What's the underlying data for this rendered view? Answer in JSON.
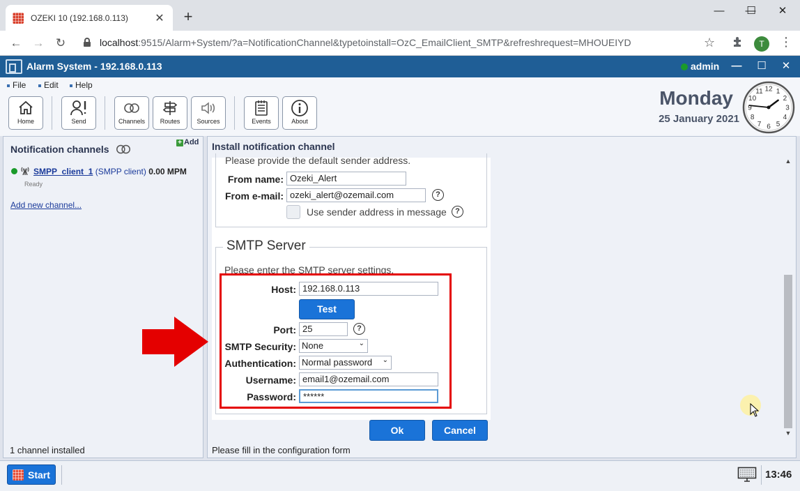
{
  "browser": {
    "tab_title": "OZEKI 10 (192.168.0.113)",
    "tab_close": "✕",
    "new_tab": "+",
    "url_host": "localhost",
    "url_path": ":9515/Alarm+System/?a=NotificationChannel&typetoinstall=OzC_EmailClient_SMTP&refreshrequest=MHOUEIYD",
    "profile_initial": "T",
    "back": "←",
    "forward": "→",
    "reload": "↻",
    "star": "☆",
    "menu": "⋮",
    "minimize": "—",
    "maximize": "☐",
    "close": "✕"
  },
  "app": {
    "title": "Alarm System - 192.168.0.113",
    "user": "admin",
    "minimize": "—",
    "maximize": "☐",
    "close": "✕"
  },
  "menu": {
    "file": "File",
    "edit": "Edit",
    "help": "Help"
  },
  "toolbar": {
    "home": "Home",
    "send": "Send",
    "channels": "Channels",
    "routes": "Routes",
    "sources": "Sources",
    "events": "Events",
    "about": "About"
  },
  "datetime": {
    "day": "Monday",
    "date": "25 January 2021",
    "clock_hour": 1,
    "clock_minute": 46,
    "time": "13:46"
  },
  "left_panel": {
    "title": "Notification channels",
    "add": "Add",
    "channel": {
      "name": "SMPP_client_1",
      "type_open": "(",
      "type": "SMPP client",
      "type_close": ")",
      "rate": "0.00 MPM",
      "status": "Ready"
    },
    "add_new_link": "Add new channel...",
    "footer": "1 channel installed"
  },
  "right_panel": {
    "title": "Install notification channel",
    "sender": {
      "hint": "Please provide the default sender address.",
      "from_name_label": "From name:",
      "from_name_value": "Ozeki_Alert",
      "from_email_label": "From e-mail:",
      "from_email_value": "ozeki_alert@ozemail.com",
      "use_sender_label": "Use sender address in message"
    },
    "smtp": {
      "legend": "SMTP Server",
      "hint": "Please enter the SMTP server settings.",
      "host_label": "Host:",
      "host_value": "192.168.0.113",
      "test_button": "Test",
      "port_label": "Port:",
      "port_value": "25",
      "security_label": "SMTP Security:",
      "security_value": "None",
      "auth_label": "Authentication:",
      "auth_value": "Normal password",
      "username_label": "Username:",
      "username_value": "email1@ozemail.com",
      "password_label": "Password:",
      "password_value": "******"
    },
    "help_glyph": "?",
    "ok_button": "Ok",
    "cancel_button": "Cancel",
    "footer": "Please fill in the configuration form"
  },
  "taskbar": {
    "start": "Start"
  },
  "colors": {
    "app_titlebar": "#1f5e96",
    "accent_button": "#1a73d8",
    "highlight_box": "#e40000",
    "status_green": "#1a9a2a"
  }
}
